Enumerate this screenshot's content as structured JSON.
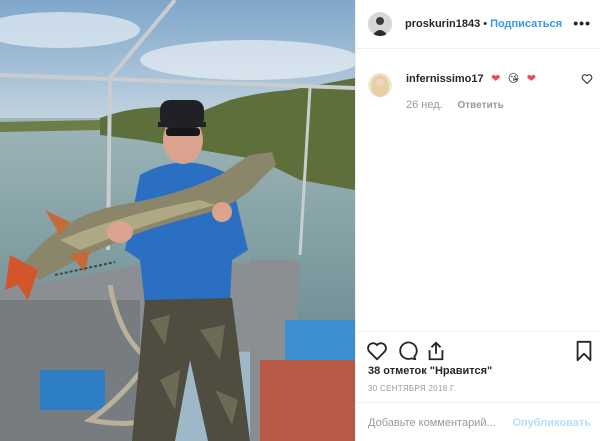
{
  "post": {
    "author": "proskurin1843",
    "separator": "•",
    "follow_label": "Подписаться",
    "more_label": "•••"
  },
  "comment": {
    "username": "infernissimo17",
    "emojis": [
      "❤",
      "😘",
      "❤"
    ],
    "time": "26 нед.",
    "reply_label": "Ответить"
  },
  "stats": {
    "likes": "38 отметок \"Нравится\"",
    "date": "30 СЕНТЯБРЯ 2018 Г."
  },
  "composer": {
    "placeholder": "Добавьте комментарий...",
    "publish_label": "Опубликовать"
  },
  "icons": [
    "heart-icon",
    "comment-icon",
    "share-icon",
    "bookmark-icon",
    "more-options-icon",
    "like-comment-icon"
  ],
  "colors": {
    "link": "#3897f0",
    "publish_disabled": "#b2dffc",
    "meta": "#999999",
    "text": "#262626"
  }
}
